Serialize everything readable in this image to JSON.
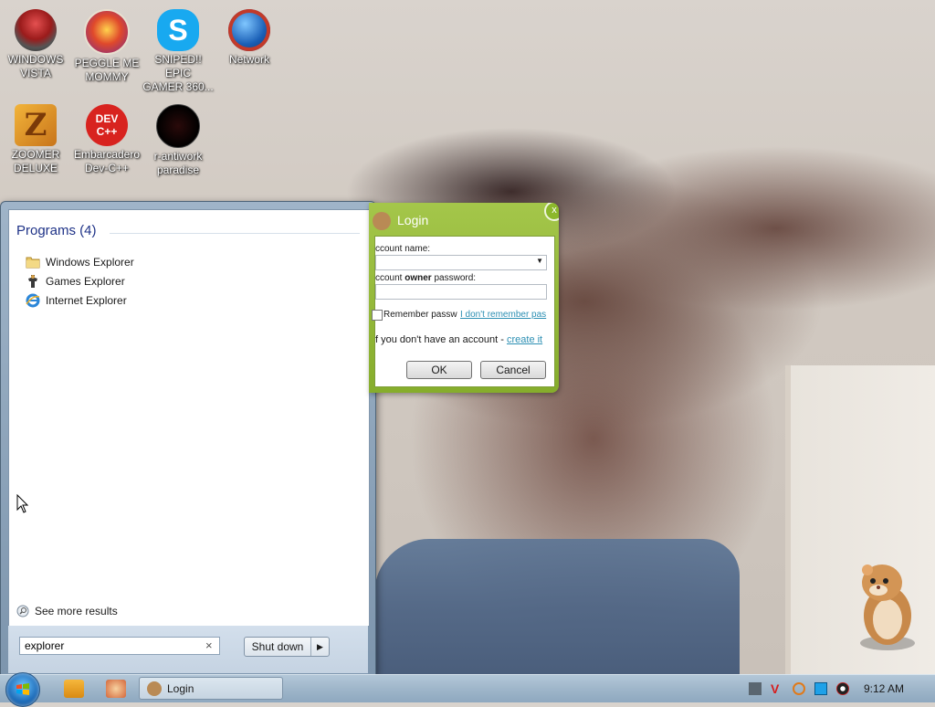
{
  "desktop_icons": [
    {
      "label": "WINDOWS\nVISTA",
      "name": "windows-vista-icon"
    },
    {
      "label": "PEGGLE ME\nMOMMY",
      "name": "peggle-icon"
    },
    {
      "label": "SNIPED!! EPIC\nGAMER 360...",
      "name": "skype-icon"
    },
    {
      "label": "Network",
      "name": "network-icon"
    },
    {
      "label": "ZOOMER\nDELUXE",
      "name": "zoomer-deluxe-icon"
    },
    {
      "label": "Embarcadero\nDev-C++",
      "name": "devcpp-icon"
    },
    {
      "label": "r-antiwork\nparadise",
      "name": "antiwork-icon"
    }
  ],
  "devcpp_logo_text": "DEV C++",
  "start_menu": {
    "programs_header": "Programs (4)",
    "programs": [
      {
        "label": "Windows Explorer",
        "icon": "folder-icon"
      },
      {
        "label": "Games Explorer",
        "icon": "games-explorer-icon"
      },
      {
        "label": "Internet Explorer",
        "icon": "internet-explorer-icon"
      }
    ],
    "see_more": "See more results",
    "search_value": "explorer",
    "shutdown_label": "Shut down",
    "shutdown_arrow": "▶",
    "clear": "×"
  },
  "login": {
    "title": "Login",
    "close": "x",
    "account_name_label": "ccount name:",
    "password_label_pre": "ccount ",
    "password_label_bold": "owner",
    "password_label_post": " password:",
    "remember_label": "Remember passw",
    "forgot_link": "I don't remember pas",
    "no_account_text": "f you don't have an account - ",
    "create_link": "create it",
    "ok_label": "OK",
    "cancel_label": "Cancel"
  },
  "taskbar": {
    "active_task": "Login",
    "clock": "9:12 AM"
  },
  "colors": {
    "login_green": "#86ad2c",
    "link_blue": "#2c8fb3",
    "start_header_blue": "#1e3287"
  }
}
